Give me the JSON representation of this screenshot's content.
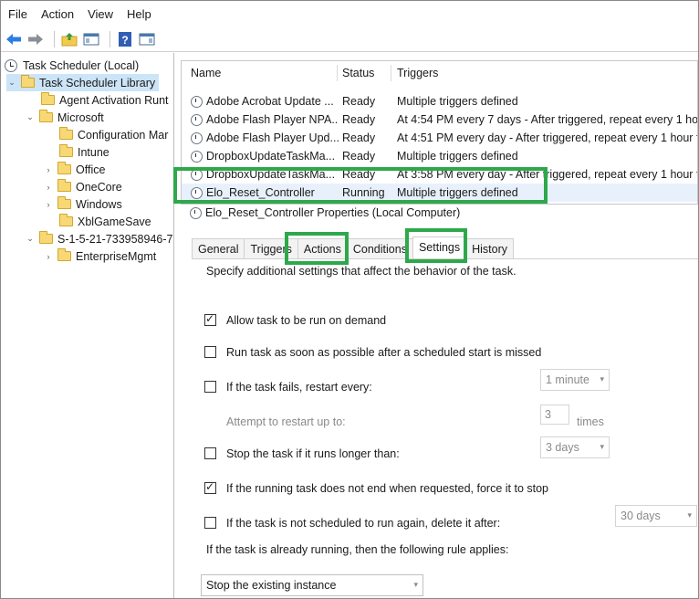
{
  "menu": [
    "File",
    "Action",
    "View",
    "Help"
  ],
  "tree": {
    "root": "Task Scheduler (Local)",
    "library": "Task Scheduler Library",
    "items": {
      "agent": "Agent Activation Runt",
      "microsoft": "Microsoft",
      "config": "Configuration Mar",
      "intune": "Intune",
      "office": "Office",
      "onecore": "OneCore",
      "windows": "Windows",
      "xbl": "XblGameSave",
      "sid": "S-1-5-21-733958946-7",
      "enterprise": "EnterpriseMgmt"
    }
  },
  "tasks": {
    "headers": {
      "name": "Name",
      "status": "Status",
      "triggers": "Triggers"
    },
    "rows": [
      {
        "name": "Adobe Acrobat Update ...",
        "status": "Ready",
        "triggers": "Multiple triggers defined"
      },
      {
        "name": "Adobe Flash Player NPA...",
        "status": "Ready",
        "triggers": "At 4:54 PM every 7 days - After triggered, repeat every 1 hou"
      },
      {
        "name": "Adobe Flash Player Upd...",
        "status": "Ready",
        "triggers": "At 4:51 PM every day - After triggered, repeat every 1 hour fo"
      },
      {
        "name": "DropboxUpdateTaskMa...",
        "status": "Ready",
        "triggers": "Multiple triggers defined"
      },
      {
        "name": "DropboxUpdateTaskMa...",
        "status": "Ready",
        "triggers": "At 3:58 PM every day - After triggered, repeat every 1 hour fo"
      },
      {
        "name": "Elo_Reset_Controller",
        "status": "Running",
        "triggers": "Multiple triggers defined"
      }
    ]
  },
  "properties_title": "Elo_Reset_Controller Properties (Local Computer)",
  "tabs": [
    "General",
    "Triggers",
    "Actions",
    "Conditions",
    "Settings",
    "History"
  ],
  "settings": {
    "intro": "Specify additional settings that affect the behavior of the task.",
    "allow_demand": "Allow task to be run on demand",
    "run_asap": "Run task as soon as possible after a scheduled start is missed",
    "restart_every": "If the task fails, restart every:",
    "restart_interval": "1 minute",
    "attempt_label": "Attempt to restart up to:",
    "attempt_value": "3",
    "attempt_unit": "times",
    "stop_longer": "Stop the task if it runs longer than:",
    "stop_duration": "3 days",
    "force_stop": "If the running task does not end when requested, force it to stop",
    "delete_after": "If the task is not scheduled to run again, delete it after:",
    "delete_duration": "30 days",
    "rule_label": "If the task is already running, then the following rule applies:",
    "rule_value": "Stop the existing instance"
  },
  "colors": {
    "highlight": "#2ea84a",
    "selection": "#cce4f7"
  }
}
